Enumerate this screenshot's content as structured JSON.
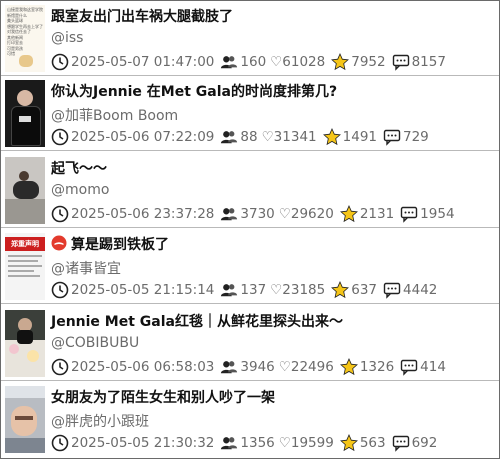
{
  "posts": [
    {
      "title": "跟室友出门出车祸大腿截肢了",
      "author": "@iss",
      "time": "2025-05-07 01:47:00",
      "views": "160",
      "likes": "♡61028",
      "stars": "7952",
      "comments": "8157",
      "thumb_lines": [
        "山接是我和这室学院",
        "新馆是什么",
        "美头篮球",
        "想跟学生再去上学了",
        "对我信任去了",
        "其他新闻",
        "打印室去",
        "可是男孩",
        "可惜"
      ]
    },
    {
      "title": "你认为Jennie 在Met Gala的时尚度排第几?",
      "author": "@加菲Boom Boom",
      "time": "2025-05-06 07:22:09",
      "views": "88",
      "likes": "♡31341",
      "stars": "1491",
      "comments": "729"
    },
    {
      "title": "起飞～～",
      "author": "@momo",
      "time": "2025-05-06 23:37:28",
      "views": "3730",
      "likes": "♡29620",
      "stars": "2131",
      "comments": "1954"
    },
    {
      "title": "算是踢到铁板了",
      "author": "@诸事皆宜",
      "time": "2025-05-05 21:15:14",
      "views": "137",
      "likes": "♡23185",
      "stars": "637",
      "comments": "4442",
      "thumb_header": "郑重声明"
    },
    {
      "title": "Jennie Met Gala红毯｜从鲜花里探头出来～",
      "author": "@COBIBUBU",
      "time": "2025-05-06 06:58:03",
      "views": "3946",
      "likes": "♡22496",
      "stars": "1326",
      "comments": "414"
    },
    {
      "title": "女朋友为了陌生女生和别人吵了一架",
      "author": "@胖虎的小跟班",
      "time": "2025-05-05 21:30:32",
      "views": "1356",
      "likes": "♡19599",
      "stars": "563",
      "comments": "692"
    }
  ],
  "icons": {
    "clock": "clock-icon",
    "views": "people-icon",
    "star": "star-icon",
    "comment": "comment-icon",
    "emoji": "sulking-face-icon"
  },
  "colors": {
    "star_fill": "#f5c518",
    "meta_text": "#6b6b6b",
    "divider": "#b9b9b9",
    "thumb4_red": "#cc1f1f"
  }
}
